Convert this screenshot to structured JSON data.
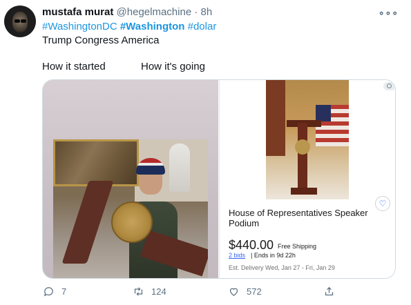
{
  "tweet": {
    "author_name": "mustafa murat",
    "handle": "@hegelmachine",
    "separator": "·",
    "time": "8h",
    "more_icon": "ellipsis-icon",
    "hashtags": [
      "#WashingtonDC",
      "#Washington",
      "#dolar"
    ],
    "body_line": "Trump Congress America",
    "left_caption": "How it started",
    "right_caption": "How it's going"
  },
  "listing": {
    "title": "House of Representatives Speaker Podium",
    "price": "$440.00",
    "shipping": "Free Shipping",
    "bids": "2 bids",
    "ends": "| Ends in 9d 22h",
    "delivery": "Est. Delivery Wed, Jan 27 - Fri, Jan 29",
    "accent_color": "#3665f3"
  },
  "actions": {
    "reply_count": "7",
    "retweet_count": "124",
    "like_count": "572",
    "share_icon": "share-icon"
  },
  "colors": {
    "hashtag": "#1b95e0",
    "muted": "#5b7083"
  }
}
